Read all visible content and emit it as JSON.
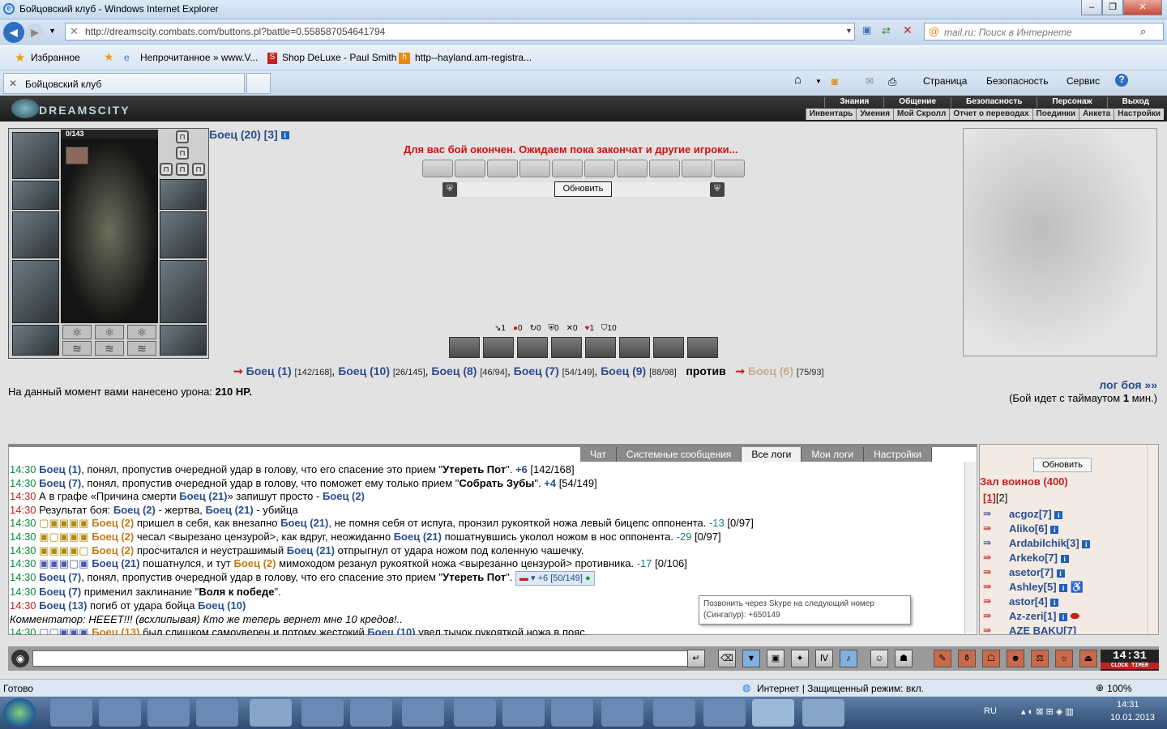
{
  "window": {
    "title": "Бойцовский клуб - Windows Internet Explorer"
  },
  "address": {
    "url": "http://dreamscity.combats.com/buttons.pl?battle=0.558587054641794",
    "search_placeholder": "mail.ru: Поиск в Интернете"
  },
  "favorites": {
    "label": "Избранное",
    "items": [
      "Непрочитанное » www.V...",
      "Shop DeLuxe - Paul Smith",
      "http--hayland.am-registra..."
    ]
  },
  "tab": {
    "title": "Бойцовский клуб"
  },
  "commands": [
    "Страница",
    "Безопасность",
    "Сервис"
  ],
  "game": {
    "logo": "DREAMSCITY",
    "menu_top": [
      "Знания",
      "Общение",
      "Безопасность",
      "Персонаж",
      "Выход"
    ],
    "menu_bottom": [
      "Инвентарь",
      "Умения",
      "Мой Скролл",
      "Отчет о переводах",
      "Поединки",
      "Анкета",
      "Настройки"
    ],
    "hp": "0/143",
    "fighter": "Боец (20) [3]",
    "battle_msg": "Для вас бой окончен. Ожидаем пока закончат и другие игроки...",
    "refresh_btn": "Обновить",
    "stats": [
      "1",
      "0",
      "0",
      "0",
      "0",
      "1",
      "10"
    ],
    "team1": [
      {
        "n": "Боец (1)",
        "hp": "[142/168]"
      },
      {
        "n": "Боец (10)",
        "hp": "[26/145]"
      },
      {
        "n": "Боец (8)",
        "hp": "[46/94]"
      },
      {
        "n": "Боец (7)",
        "hp": "[54/149]"
      },
      {
        "n": "Боец (9)",
        "hp": "[88/98]"
      }
    ],
    "vs": "против",
    "team2": {
      "n": "Боец (6)",
      "hp": "[75/93]"
    },
    "damage_label": "На данный момент вами нанесено урона:",
    "damage_value": "210 HP.",
    "log_link": "лог боя »»",
    "timeout": "(Бой идет с таймаутом",
    "timeout_num": "1",
    "timeout_end": "мин.)"
  },
  "chat": {
    "tabs": [
      "Чат",
      "Системные сообщения",
      "Все логи",
      "Мои логи",
      "Настройки"
    ],
    "tooltip1": "Позвонить через Skype на следующий номер",
    "tooltip2": "(Сингапур): +650149",
    "skype_val": "+6 [50/149]"
  },
  "hall": {
    "refresh": "Обновить",
    "title": "Зал воинов (400)",
    "pages": [
      "[1]",
      "[2]"
    ],
    "users": [
      "acgoz[7]",
      "Aliko[6]",
      "Ardabilchik[3]",
      "Arkeko[7]",
      "asetor[7]",
      "Ashley[5]",
      "astor[4]",
      "Az-zeri[1]",
      "AZE BAKU[7]"
    ]
  },
  "clock": {
    "time": "14:31",
    "labels": "CLOCK TIMER"
  },
  "status": {
    "ready": "Готово",
    "zone": "Интернет | Защищенный режим: вкл.",
    "zoom": "100%"
  },
  "tray": {
    "lang": "RU",
    "time": "14:31",
    "date": "10.01.2013"
  }
}
